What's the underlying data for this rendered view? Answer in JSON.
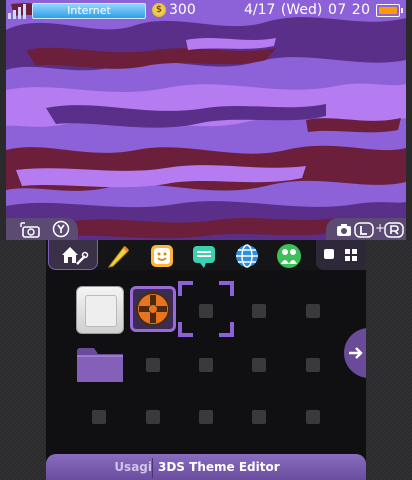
{
  "status_bar": {
    "connection_label": "Internet",
    "coin_symbol": "$",
    "coin_count": "300",
    "date": "4/17 (Wed)",
    "time": "07 20",
    "battery_color": "#ff9a00"
  },
  "top_screen": {
    "left_tab_icons": [
      "camera-icon",
      "y-button-icon"
    ],
    "right_tab_icons": [
      "camera-icon",
      "l-button-icon",
      "r-button-icon"
    ],
    "background_colors": [
      "#8d62d8",
      "#b47cf0",
      "#5a2f8a",
      "#6b1f3a"
    ]
  },
  "toolbar": {
    "icons": [
      "home-settings-icon",
      "notes-icon",
      "friends-icon",
      "notifications-icon",
      "browser-icon",
      "miiverse-icon"
    ],
    "view_icons": [
      "single-view-icon",
      "grid-view-icon"
    ]
  },
  "grid": {
    "apps": [
      "blank-app-icon",
      "tf2-theme-icon",
      "folder-icon"
    ],
    "accent_color": "#9a6ad8"
  },
  "footer": {
    "author": "Usagi",
    "title": "3DS Theme Editor"
  }
}
